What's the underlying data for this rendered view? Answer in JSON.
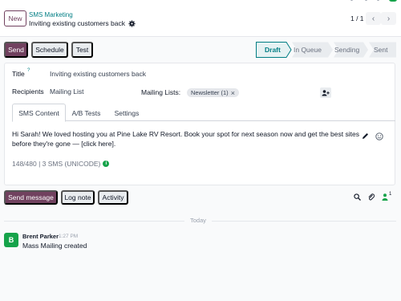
{
  "header": {
    "new_label": "New",
    "breadcrumb_parent": "SMS Marketing",
    "record_title": "Inviting existing customers back",
    "pager": "1 / 1"
  },
  "toolbar": {
    "send_label": "Send",
    "schedule_label": "Schedule",
    "test_label": "Test"
  },
  "statusbar": {
    "stages": [
      "Draft",
      "In Queue",
      "Sending",
      "Sent"
    ],
    "active_stage": "Draft"
  },
  "form": {
    "title_label": "Title",
    "title_help": "?",
    "title_value": "Inviting existing customers back",
    "recipients_label": "Recipients",
    "recipients_value": "Mailing List",
    "mailing_lists_label": "Mailing Lists:",
    "mailing_list_tag": "Newsletter (1)",
    "tabs": [
      "SMS Content",
      "A/B Tests",
      "Settings"
    ],
    "active_tab": "SMS Content",
    "sms_body": "Hi Sarah! We loved hosting you at Pine Lake RV Resort. Book your spot for next season now and get the best sites before they're gone — [click here].",
    "sms_counter": "148/480 | 3 SMS (UNICODE)"
  },
  "chatter": {
    "send_message_label": "Send message",
    "log_note_label": "Log note",
    "activity_label": "Activity",
    "followers_count": "1",
    "date_separator": "Today",
    "messages": [
      {
        "avatar_initial": "B",
        "author": "Brent Parker",
        "time": "1:27 PM",
        "body": "Mass Mailing created"
      }
    ]
  },
  "colors": {
    "primary": "#71415f",
    "teal": "#017e84",
    "avatar_green": "#16a34a"
  }
}
